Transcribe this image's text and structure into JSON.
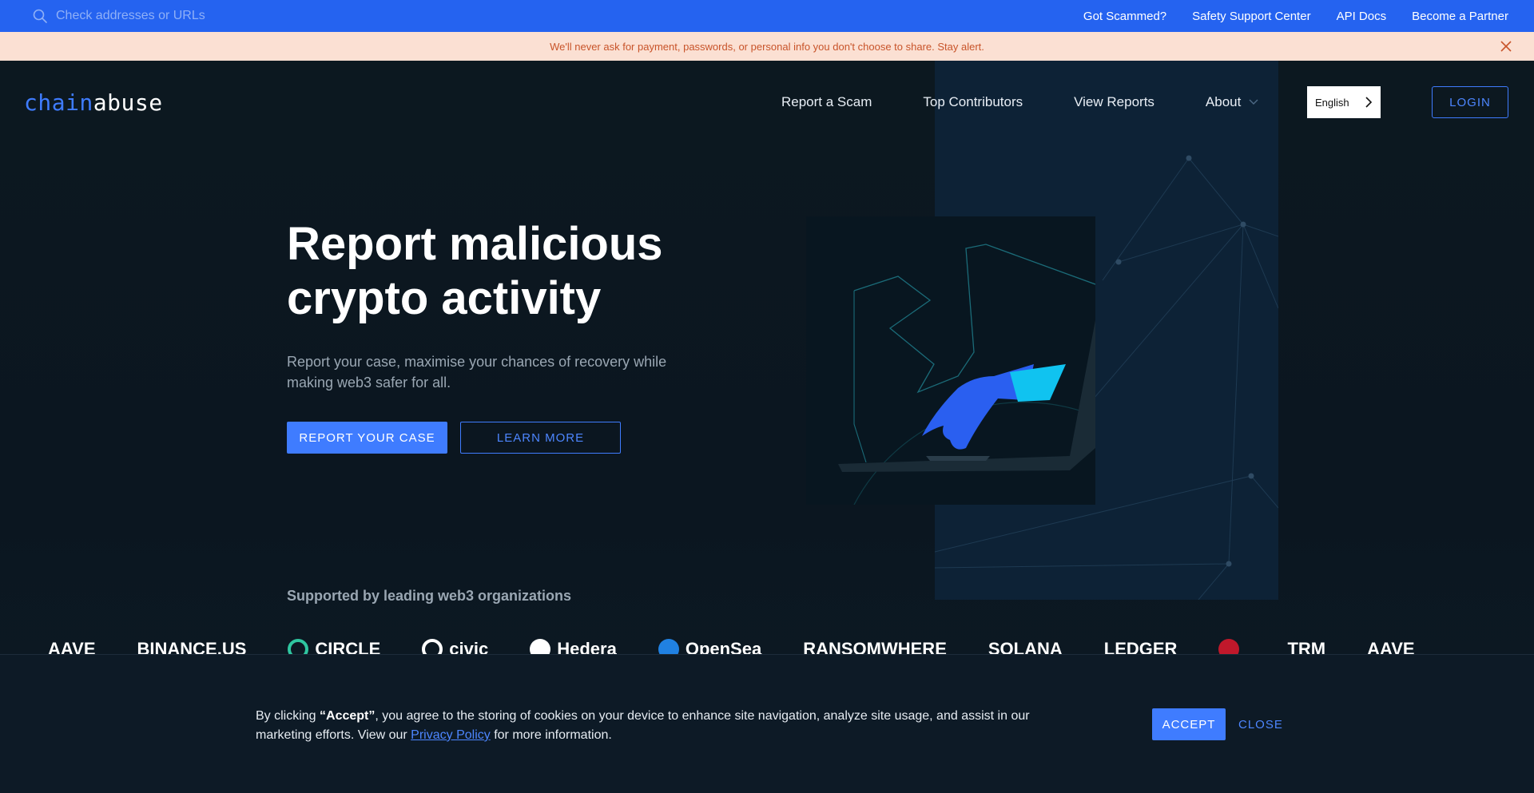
{
  "topbar": {
    "search_placeholder": "Check addresses or URLs",
    "links": [
      "Got Scammed?",
      "Safety Support Center",
      "API Docs",
      "Become a Partner"
    ]
  },
  "alert": {
    "message": "We'll never ask for payment, passwords, or personal info you don't choose to share. Stay alert."
  },
  "nav": {
    "logo_part1": "chain",
    "logo_part2": "abuse",
    "links": [
      "Report a Scam",
      "Top Contributors",
      "View Reports",
      "About"
    ],
    "language": "English",
    "login": "LOGIN"
  },
  "hero": {
    "title_line1": "Report malicious",
    "title_line2": "crypto activity",
    "subtitle": "Report your case, maximise your chances of recovery while making web3 safer for all.",
    "primary_button": "REPORT YOUR CASE",
    "secondary_button": "LEARN MORE"
  },
  "supported": {
    "heading": "Supported by leading web3 organizations",
    "brands": [
      "AAVE",
      "BINANCE.US",
      "CIRCLE",
      "civic",
      "Hedera",
      "OpenSea",
      "RANSOMWHERE",
      "SOLANA",
      "LEDGER",
      "",
      "TRM",
      "AAVE"
    ]
  },
  "cookie": {
    "text_prefix": "By clicking ",
    "accept_word": "“Accept”",
    "text_middle": ", you agree to the storing of cookies on your device to enhance site navigation, analyze site usage, and assist in our marketing efforts. View our ",
    "privacy_link": "Privacy Policy",
    "text_suffix": " for more information.",
    "accept_button": "ACCEPT",
    "close_button": "CLOSE"
  },
  "colors": {
    "topbar": "#2563f0",
    "alert_bg": "#fbe0d3",
    "alert_text": "#c8542a",
    "accent": "#3f7cff",
    "background": "#0b1620"
  }
}
